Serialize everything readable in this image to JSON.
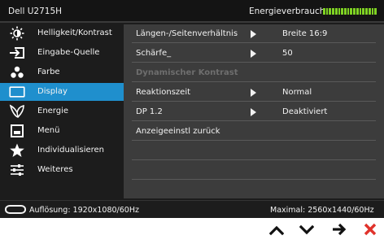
{
  "header": {
    "model": "Dell U2715H",
    "energy_label": "Energieverbrauch",
    "energy_level": 1.0,
    "energy_color": "#7fd323"
  },
  "sidebar": {
    "accent": "#1f8fcd",
    "items": [
      {
        "label": "Helligkeit/Kontrast",
        "icon": "brightness-icon",
        "active": false
      },
      {
        "label": "Eingabe-Quelle",
        "icon": "input-source-icon",
        "active": false
      },
      {
        "label": "Farbe",
        "icon": "color-icon",
        "active": false
      },
      {
        "label": "Display",
        "icon": "display-icon",
        "active": true
      },
      {
        "label": "Energie",
        "icon": "energy-icon",
        "active": false
      },
      {
        "label": "Menü",
        "icon": "menu-icon",
        "active": false
      },
      {
        "label": "Individualisieren",
        "icon": "star-icon",
        "active": false
      },
      {
        "label": "Weiteres",
        "icon": "settings-sliders-icon",
        "active": false
      }
    ]
  },
  "display_settings": {
    "rows": [
      {
        "label": "Längen-/Seitenverhältnis",
        "value": "Breite 16:9",
        "arrow": true,
        "disabled": false
      },
      {
        "label": "Schärfe_",
        "value": "50",
        "arrow": true,
        "disabled": false
      },
      {
        "label": "Dynamischer Kontrast",
        "value": "",
        "arrow": false,
        "disabled": true
      },
      {
        "label": "Reaktionszeit",
        "value": "Normal",
        "arrow": true,
        "disabled": false
      },
      {
        "label": "DP 1.2",
        "value": "Deaktiviert",
        "arrow": true,
        "disabled": false
      },
      {
        "label": "Anzeigeeinstl zurück",
        "value": "",
        "arrow": false,
        "disabled": false
      }
    ]
  },
  "status": {
    "resolution": "Auflösung: 1920x1080/60Hz",
    "maximal": "Maximal: 2560x1440/60Hz"
  },
  "buttons": {
    "up": "chevron-up-icon",
    "down": "chevron-down-icon",
    "enter": "arrow-right-icon",
    "exit": "close-icon",
    "exit_color": "#e0322b"
  }
}
